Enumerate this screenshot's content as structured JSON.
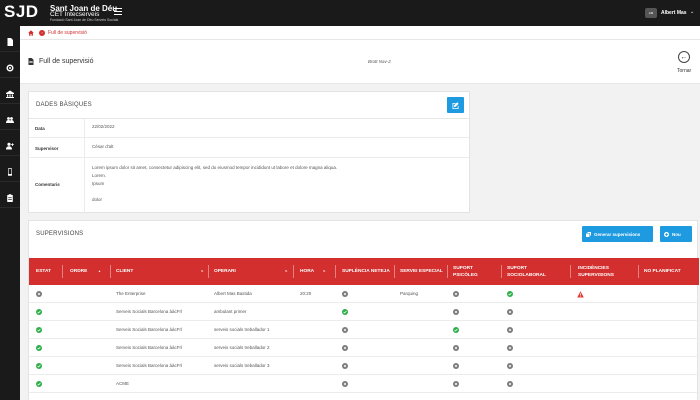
{
  "header": {
    "logo_mark": "SJD",
    "logo_name": "Sant Joan de Déu",
    "logo_subtitle": "CET Intecserveis",
    "logo_foundation": "Fundació Sant Joan de Déu Serveis Socials",
    "user_initials": "AM",
    "user_name": "Albert Mas",
    "user_chevron": "⌄"
  },
  "breadcrumb": {
    "current": "Full de supervisió"
  },
  "page": {
    "title": "Full de supervisió",
    "center_label": "Brott Nav-2",
    "back_label": "Tornar"
  },
  "basic": {
    "title": "DADES BÀSIQUES",
    "rows": [
      {
        "label": "Data",
        "value": "22/02/2022"
      },
      {
        "label": "Supervisor",
        "value": "Cèsar d'alt"
      },
      {
        "label": "Comentaris",
        "lines": [
          "Lorem ipsum dolor sit amet, consectetur adipiscing elit, sed do eiusmod tempor incididunt ut labore et dolore magna aliqua.",
          "Lorem.",
          "Ipsum",
          "",
          "dolor"
        ]
      }
    ]
  },
  "supervisions": {
    "title": "SUPERVISIONS",
    "generate_label": "Generar supervisions",
    "new_label": "Nou",
    "columns": {
      "estat": "ESTAT",
      "ordre": "ORDRE",
      "client": "CLIENT",
      "operari": "OPERARI",
      "hora": "HORA",
      "suplencia": "SUPLÈNCIA NETEJA",
      "servei": "SERVEI ESPECIAL",
      "psicoleg": "SUPORT PSICÒLEG",
      "sociolaboral": "SUPORT SOCIOLABORAL",
      "incidencies": "INCIDÈNCIES SUPERVISIONS",
      "noplan": "NO PLANIFICAT"
    },
    "rows": [
      {
        "estat": "x",
        "client": "The Enterprise",
        "operari": "Albert Mas Bastida",
        "hora": "20:20",
        "suplencia": "x",
        "servei": "Parquing",
        "psicoleg": "x",
        "sociolaboral": "ok",
        "incidencia": "warn"
      },
      {
        "estat": "ok",
        "client": "Serveis Socials Barcelona ààcFrl",
        "operari": "ambulant primer",
        "hora": "",
        "suplencia": "ok",
        "servei": "",
        "psicoleg": "x",
        "sociolaboral": "x",
        "incidencia": ""
      },
      {
        "estat": "ok",
        "client": "Serveis Socials Barcelona ààcFrl",
        "operari": "serveis socials treballador 1",
        "hora": "",
        "suplencia": "x",
        "servei": "",
        "psicoleg": "ok",
        "sociolaboral": "x",
        "incidencia": ""
      },
      {
        "estat": "ok",
        "client": "Serveis Socials Barcelona ààcFrl",
        "operari": "serveis socials treballador 2",
        "hora": "",
        "suplencia": "x",
        "servei": "",
        "psicoleg": "x",
        "sociolaboral": "x",
        "incidencia": ""
      },
      {
        "estat": "ok",
        "client": "Serveis Socials Barcelona ààcFrl",
        "operari": "serveis socials treballador 3",
        "hora": "",
        "suplencia": "x",
        "servei": "",
        "psicoleg": "x",
        "sociolaboral": "x",
        "incidencia": ""
      },
      {
        "estat": "ok",
        "client": "ACME",
        "operari": "",
        "hora": "",
        "suplencia": "x",
        "servei": "",
        "psicoleg": "x",
        "sociolaboral": "x",
        "incidencia": ""
      }
    ]
  },
  "colors": {
    "accent": "#1e9be0",
    "table_header": "#d32f2f",
    "ok": "#2eaf4a",
    "neutral": "#7a7a7a",
    "warn": "#e53935"
  }
}
